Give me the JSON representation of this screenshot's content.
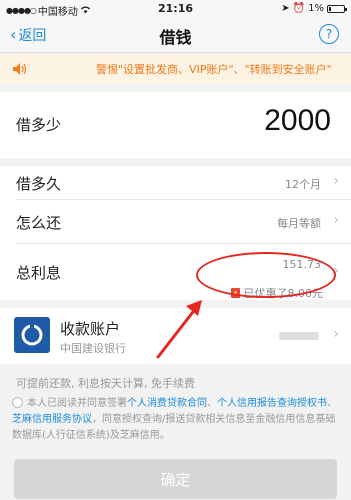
{
  "status_bar": {
    "carrier": "中国移动",
    "time": "21:16",
    "battery": "1%"
  },
  "nav": {
    "back_label": "返回",
    "title": "借钱",
    "help_label": "?"
  },
  "warning": {
    "text": "警惕\"设置批发商、VIP账户\"、\"转账到安全账户\""
  },
  "amount_row": {
    "label": "借多少",
    "value": "2000"
  },
  "term_row": {
    "label": "借多久",
    "value": "12个月"
  },
  "repay_row": {
    "label": "怎么还",
    "value": "每月等额"
  },
  "interest_row": {
    "label": "总利息",
    "value": "151.73",
    "benefit_text": "已优惠了8.00元"
  },
  "receiving": {
    "label": "收款账户",
    "bank": "中国建设银行"
  },
  "note": "可提前还款, 利息按天计算, 免手续费",
  "agreement": {
    "prefix": "本人已阅读并同意签署",
    "link1": "个人消费贷款合同",
    "sep1": "、",
    "link2": "个人信用报告查询授权书",
    "sep2": "、",
    "link3": "芝麻信用服务协议",
    "suffix": "，同意授权查询/报送贷款相关信息至金融信用信息基础数据库(人行征信系统)及芝麻信用。"
  },
  "confirm_label": "确定",
  "colors": {
    "accent": "#1a8cd8",
    "warning": "#f07a1f",
    "annotation": "#e3281f"
  }
}
